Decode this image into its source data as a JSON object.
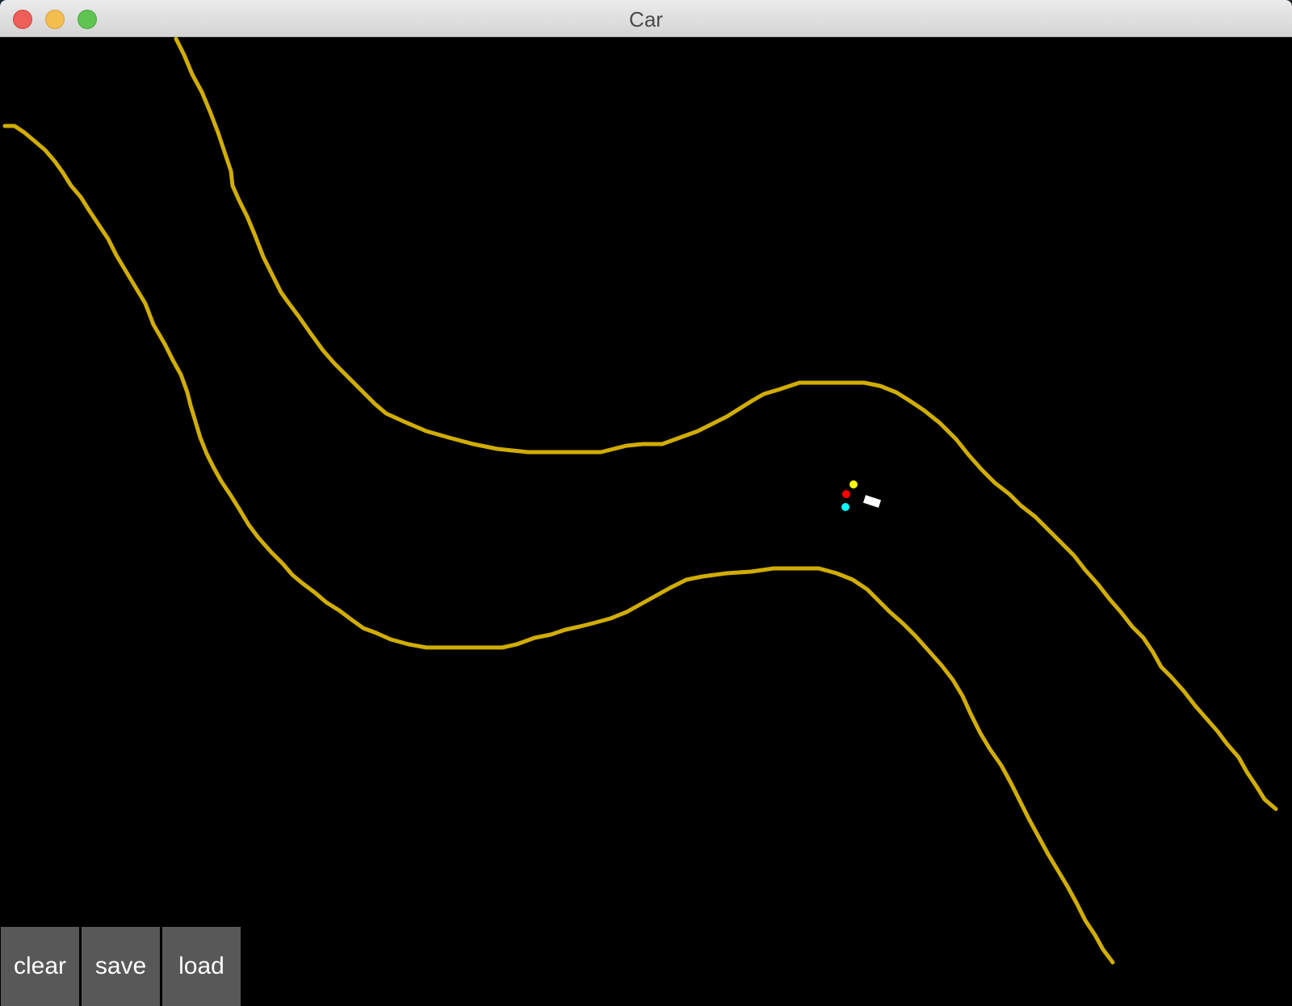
{
  "window": {
    "title": "Car"
  },
  "colors": {
    "road_border": "#d0ad00",
    "background": "#000000",
    "car_body": "#ffffff",
    "sensor_left": "#ffff00",
    "sensor_center": "#ff0000",
    "sensor_right": "#00ffff",
    "button_bg": "#585858"
  },
  "controls": {
    "clear_label": "clear",
    "save_label": "save",
    "load_label": "load"
  }
}
